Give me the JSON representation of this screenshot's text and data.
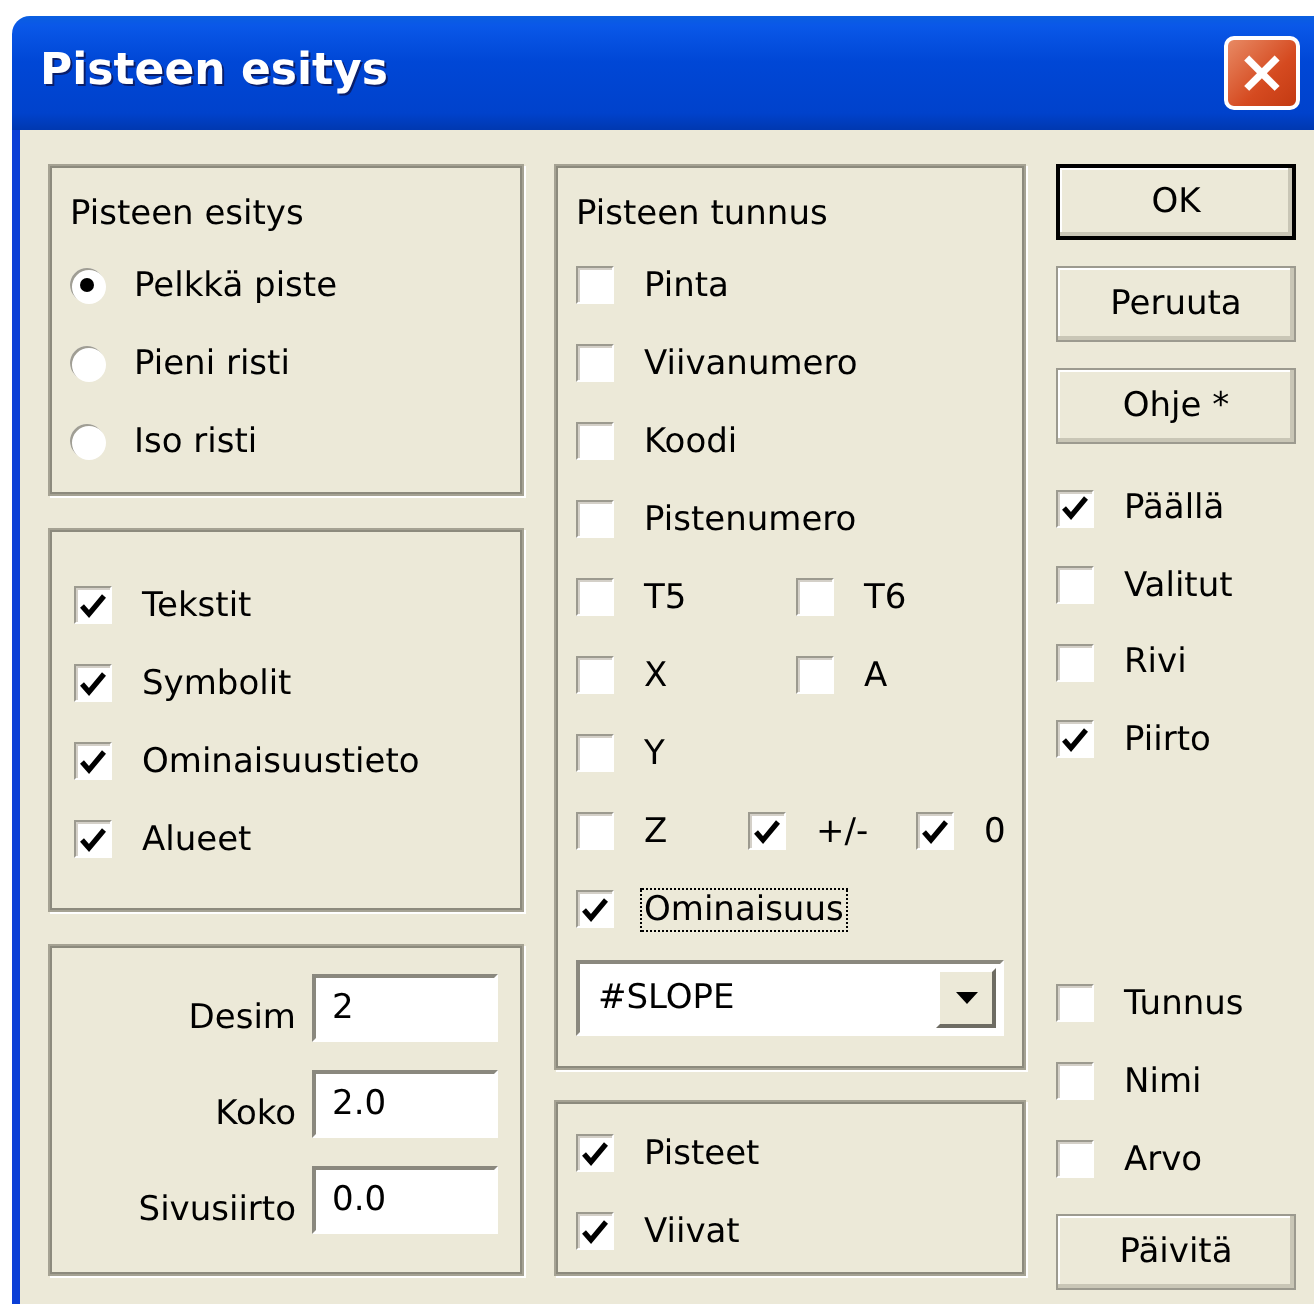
{
  "window": {
    "title": "Pisteen esitys",
    "close": "×"
  },
  "display_group": {
    "title": "Pisteen esitys",
    "options": [
      {
        "label": "Pelkkä piste",
        "selected": true
      },
      {
        "label": "Pieni risti",
        "selected": false
      },
      {
        "label": "Iso risti",
        "selected": false
      }
    ]
  },
  "layers": [
    {
      "label": "Tekstit",
      "checked": true
    },
    {
      "label": "Symbolit",
      "checked": true
    },
    {
      "label": "Ominaisuustieto",
      "checked": true
    },
    {
      "label": "Alueet",
      "checked": true
    }
  ],
  "fields": [
    {
      "label": "Desim",
      "value": "2"
    },
    {
      "label": "Koko",
      "value": "2.0"
    },
    {
      "label": "Sivusiirto",
      "value": "0.0"
    }
  ],
  "point_label_group": {
    "title": "Pisteen tunnus",
    "rows": [
      [
        {
          "label": "Pinta",
          "checked": false
        }
      ],
      [
        {
          "label": "Viivanumero",
          "checked": false
        }
      ],
      [
        {
          "label": "Koodi",
          "checked": false
        }
      ],
      [
        {
          "label": "Pistenumero",
          "checked": false
        }
      ],
      [
        {
          "label": "T5",
          "checked": false
        },
        {
          "label": "T6",
          "checked": false
        }
      ],
      [
        {
          "label": "X",
          "checked": false
        },
        {
          "label": "A",
          "checked": false
        }
      ],
      [
        {
          "label": "Y",
          "checked": false
        }
      ],
      [
        {
          "label": "Z",
          "checked": false
        },
        {
          "label": "+/-",
          "checked": true
        },
        {
          "label": "0",
          "checked": true
        }
      ],
      [
        {
          "label": "Ominaisuus",
          "checked": true,
          "focused": true
        }
      ]
    ],
    "dropdown": {
      "value": "#SLOPE"
    }
  },
  "draw_group": [
    {
      "label": "Pisteet",
      "checked": true
    },
    {
      "label": "Viivat",
      "checked": true
    }
  ],
  "buttons": [
    {
      "label": "OK",
      "default": true
    },
    {
      "label": "Peruuta",
      "default": false
    },
    {
      "label": "Ohje *",
      "default": false
    }
  ],
  "view_checks": [
    {
      "label": "Päällä",
      "checked": true
    },
    {
      "label": "Valitut",
      "checked": false
    },
    {
      "label": "Rivi",
      "checked": false
    },
    {
      "label": "Piirto",
      "checked": true
    }
  ],
  "label_checks": [
    {
      "label": "Tunnus",
      "checked": false
    },
    {
      "label": "Nimi",
      "checked": false
    },
    {
      "label": "Arvo",
      "checked": false
    }
  ],
  "update_button": {
    "label": "Päivitä",
    "default": false
  }
}
